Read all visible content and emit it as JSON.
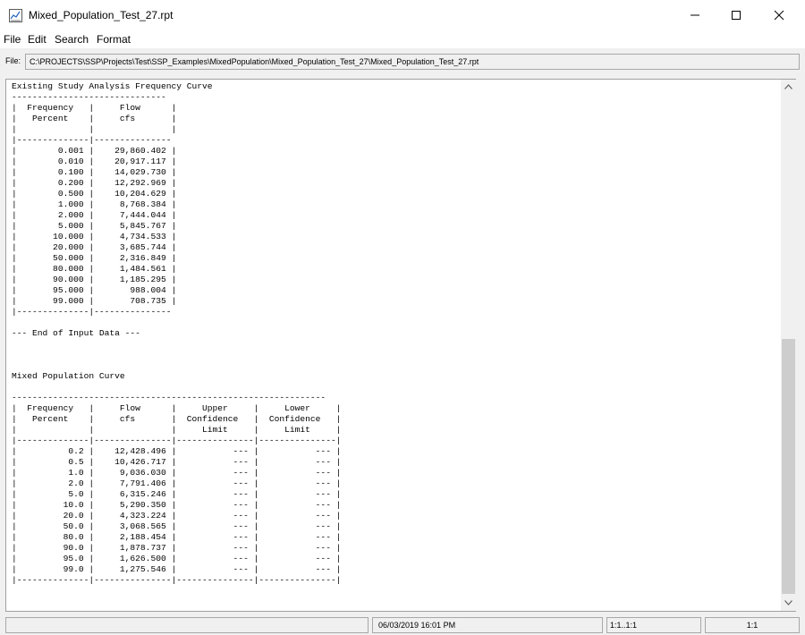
{
  "window": {
    "title": "Mixed_Population_Test_27.rpt",
    "icon": "report-file-icon"
  },
  "menu": {
    "items": [
      "File",
      "Edit",
      "Search",
      "Format"
    ]
  },
  "file": {
    "label": "File:",
    "path": "C:\\PROJECTS\\SSP\\Projects\\Test\\SSP_Examples\\MixedPopulation\\Mixed_Population_Test_27\\Mixed_Population_Test_27.rpt"
  },
  "report": {
    "lines": [
      "Existing Study Analysis Frequency Curve",
      "------------------------------",
      "|  Frequency   |     Flow      |",
      "|   Percent    |     cfs       |",
      "|              |               |",
      "|--------------|---------------",
      "|        0.001 |    29,860.402 |",
      "|        0.010 |    20,917.117 |",
      "|        0.100 |    14,029.730 |",
      "|        0.200 |    12,292.969 |",
      "|        0.500 |    10,204.629 |",
      "|        1.000 |     8,768.384 |",
      "|        2.000 |     7,444.044 |",
      "|        5.000 |     5,845.767 |",
      "|       10.000 |     4,734.533 |",
      "|       20.000 |     3,685.744 |",
      "|       50.000 |     2,316.849 |",
      "|       80.000 |     1,484.561 |",
      "|       90.000 |     1,185.295 |",
      "|       95.000 |       988.004 |",
      "|       99.000 |       708.735 |",
      "|--------------|---------------",
      "",
      "--- End of Input Data ---",
      "",
      "",
      "",
      "Mixed Population Curve",
      "",
      "-------------------------------------------------------------",
      "|  Frequency   |     Flow      |     Upper     |     Lower     |",
      "|   Percent    |     cfs       |  Confidence   |  Confidence   |",
      "|              |               |     Limit     |     Limit     |",
      "|--------------|---------------|---------------|---------------|",
      "|          0.2 |    12,428.496 |           --- |           --- |",
      "|          0.5 |    10,426.717 |           --- |           --- |",
      "|          1.0 |     9,036.030 |           --- |           --- |",
      "|          2.0 |     7,791.406 |           --- |           --- |",
      "|          5.0 |     6,315.246 |           --- |           --- |",
      "|         10.0 |     5,290.350 |           --- |           --- |",
      "|         20.0 |     4,323.224 |           --- |           --- |",
      "|         50.0 |     3,068.565 |           --- |           --- |",
      "|         80.0 |     2,188.454 |           --- |           --- |",
      "|         90.0 |     1,878.737 |           --- |           --- |",
      "|         95.0 |     1,626.500 |           --- |           --- |",
      "|         99.0 |     1,275.546 |           --- |           --- |",
      "|--------------|---------------|---------------|---------------|"
    ]
  },
  "status": {
    "message": "",
    "datetime": "06/03/2019 16:01 PM",
    "position": "1:1..1:1",
    "zoom": "1:1"
  }
}
